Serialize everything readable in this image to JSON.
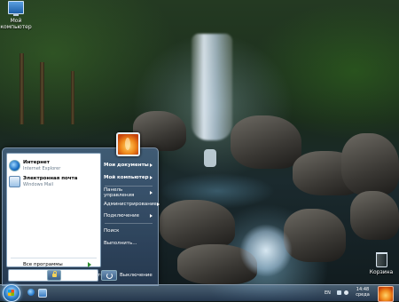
{
  "desktop": {
    "icons": {
      "my_computer": "Мой\nкомпьютер",
      "recycle_bin": "Корзина"
    }
  },
  "start_menu": {
    "pinned": [
      {
        "title": "Интернет",
        "subtitle": "Internet Explorer",
        "icon": "internet-explorer-icon"
      },
      {
        "title": "Электронная почта",
        "subtitle": "Windows Mail",
        "icon": "mail-icon"
      }
    ],
    "all_programs": "Все программы",
    "right_items": {
      "documents": "Мои документы",
      "computer": "Мой компьютер",
      "control_panel": "Панель управления",
      "admin": "Администрирование",
      "connect": "Подключение",
      "search": "Поиск",
      "run": "Выполнить..."
    },
    "logoff_label": "Выход из системы",
    "shutdown_label": "Выключение"
  },
  "taskbar": {
    "language": "EN",
    "time": "14:48",
    "day": "среда"
  }
}
